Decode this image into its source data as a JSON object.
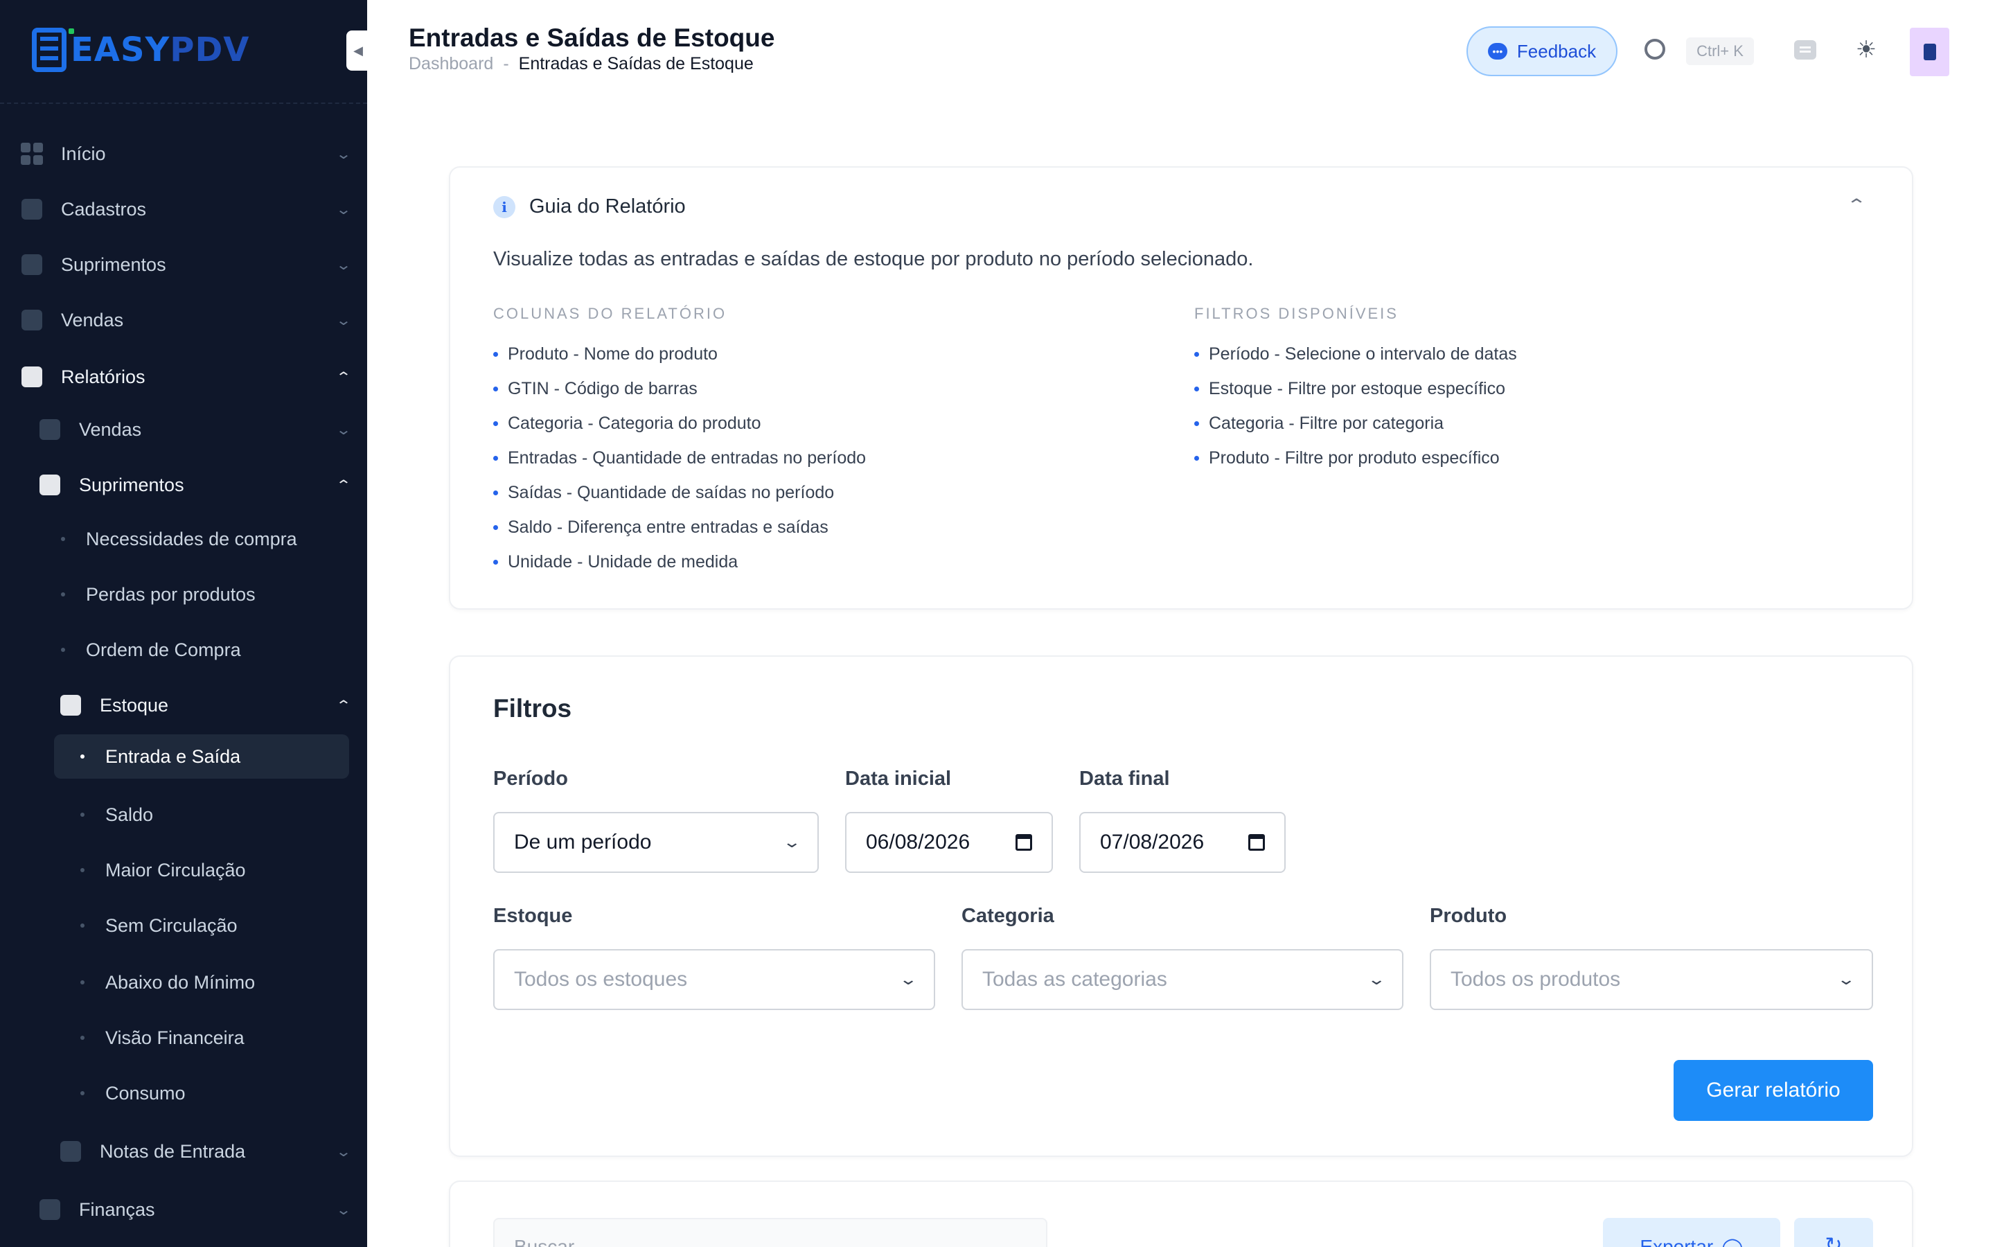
{
  "brand": {
    "name_bold": "EASY",
    "name_light": "PDV"
  },
  "sidebar": {
    "items": [
      {
        "label": "Início",
        "icon": "grid-icon"
      },
      {
        "label": "Cadastros",
        "icon": "id-card-icon"
      },
      {
        "label": "Suprimentos",
        "icon": "box-icon"
      },
      {
        "label": "Vendas",
        "icon": "register-icon"
      },
      {
        "label": "Relatórios",
        "icon": "chart-line-icon",
        "expanded": true
      }
    ],
    "reports_sub": [
      {
        "label": "Vendas",
        "icon": "register-icon"
      },
      {
        "label": "Suprimentos",
        "icon": "box-icon",
        "expanded": true
      }
    ],
    "supplies_sub": [
      "Necessidades de compra",
      "Perdas por produtos",
      "Ordem de Compra"
    ],
    "stock_group": {
      "label": "Estoque",
      "icon": "lock-icon",
      "expanded": true
    },
    "stock_sub": [
      "Entrada e Saída",
      "Saldo",
      "Maior Circulação",
      "Sem Circulação",
      "Abaixo do Mínimo",
      "Visão Financeira",
      "Consumo"
    ],
    "active_item": "Entrada e Saída",
    "notes": {
      "label": "Notas de Entrada",
      "icon": "document-icon"
    },
    "finance": {
      "label": "Finanças",
      "icon": "dollar-icon"
    }
  },
  "header": {
    "title": "Entradas e Saídas de Estoque",
    "breadcrumb": {
      "root": "Dashboard",
      "separator": "-",
      "current": "Entradas e Saídas de Estoque"
    },
    "feedback_label": "Feedback",
    "shortcut": "Ctrl+ K"
  },
  "guide": {
    "title": "Guia do Relatório",
    "description": "Visualize todas as entradas e saídas de estoque por produto no período selecionado.",
    "columns_title": "COLUNAS DO RELATÓRIO",
    "columns": [
      "Produto - Nome do produto",
      "GTIN - Código de barras",
      "Categoria - Categoria do produto",
      "Entradas - Quantidade de entradas no período",
      "Saídas - Quantidade de saídas no período",
      "Saldo - Diferença entre entradas e saídas",
      "Unidade - Unidade de medida"
    ],
    "filters_title": "FILTROS DISPONÍVEIS",
    "filters": [
      "Período - Selecione o intervalo de datas",
      "Estoque - Filtre por estoque específico",
      "Categoria - Filtre por categoria",
      "Produto - Filtre por produto específico"
    ]
  },
  "filters": {
    "title": "Filtros",
    "period": {
      "label": "Período",
      "value": "De um período"
    },
    "start_date": {
      "label": "Data inicial",
      "value": "06/08/2026"
    },
    "end_date": {
      "label": "Data final",
      "value": "07/08/2026"
    },
    "stock": {
      "label": "Estoque",
      "placeholder": "Todos os estoques"
    },
    "category": {
      "label": "Categoria",
      "placeholder": "Todas as categorias"
    },
    "product": {
      "label": "Produto",
      "placeholder": "Todos os produtos"
    },
    "generate_label": "Gerar relatório"
  },
  "results": {
    "search_placeholder": "Buscar",
    "export_label": "Exportar"
  },
  "colors": {
    "sidebar_bg": "#0f172a",
    "accent": "#1d8cf8",
    "brand": "#1d6fe8"
  }
}
